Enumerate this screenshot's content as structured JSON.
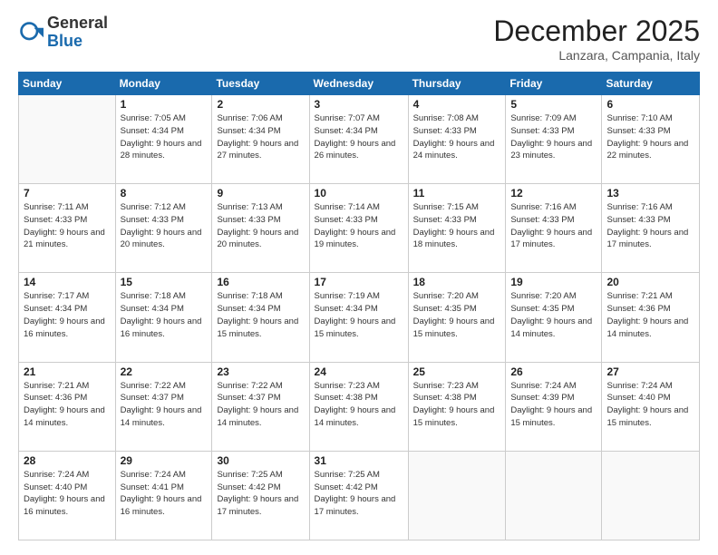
{
  "header": {
    "logo_general": "General",
    "logo_blue": "Blue",
    "month_title": "December 2025",
    "location": "Lanzara, Campania, Italy"
  },
  "weekdays": [
    "Sunday",
    "Monday",
    "Tuesday",
    "Wednesday",
    "Thursday",
    "Friday",
    "Saturday"
  ],
  "weeks": [
    [
      {
        "day": "",
        "sunrise": "",
        "sunset": "",
        "daylight": ""
      },
      {
        "day": "1",
        "sunrise": "Sunrise: 7:05 AM",
        "sunset": "Sunset: 4:34 PM",
        "daylight": "Daylight: 9 hours and 28 minutes."
      },
      {
        "day": "2",
        "sunrise": "Sunrise: 7:06 AM",
        "sunset": "Sunset: 4:34 PM",
        "daylight": "Daylight: 9 hours and 27 minutes."
      },
      {
        "day": "3",
        "sunrise": "Sunrise: 7:07 AM",
        "sunset": "Sunset: 4:34 PM",
        "daylight": "Daylight: 9 hours and 26 minutes."
      },
      {
        "day": "4",
        "sunrise": "Sunrise: 7:08 AM",
        "sunset": "Sunset: 4:33 PM",
        "daylight": "Daylight: 9 hours and 24 minutes."
      },
      {
        "day": "5",
        "sunrise": "Sunrise: 7:09 AM",
        "sunset": "Sunset: 4:33 PM",
        "daylight": "Daylight: 9 hours and 23 minutes."
      },
      {
        "day": "6",
        "sunrise": "Sunrise: 7:10 AM",
        "sunset": "Sunset: 4:33 PM",
        "daylight": "Daylight: 9 hours and 22 minutes."
      }
    ],
    [
      {
        "day": "7",
        "sunrise": "Sunrise: 7:11 AM",
        "sunset": "Sunset: 4:33 PM",
        "daylight": "Daylight: 9 hours and 21 minutes."
      },
      {
        "day": "8",
        "sunrise": "Sunrise: 7:12 AM",
        "sunset": "Sunset: 4:33 PM",
        "daylight": "Daylight: 9 hours and 20 minutes."
      },
      {
        "day": "9",
        "sunrise": "Sunrise: 7:13 AM",
        "sunset": "Sunset: 4:33 PM",
        "daylight": "Daylight: 9 hours and 20 minutes."
      },
      {
        "day": "10",
        "sunrise": "Sunrise: 7:14 AM",
        "sunset": "Sunset: 4:33 PM",
        "daylight": "Daylight: 9 hours and 19 minutes."
      },
      {
        "day": "11",
        "sunrise": "Sunrise: 7:15 AM",
        "sunset": "Sunset: 4:33 PM",
        "daylight": "Daylight: 9 hours and 18 minutes."
      },
      {
        "day": "12",
        "sunrise": "Sunrise: 7:16 AM",
        "sunset": "Sunset: 4:33 PM",
        "daylight": "Daylight: 9 hours and 17 minutes."
      },
      {
        "day": "13",
        "sunrise": "Sunrise: 7:16 AM",
        "sunset": "Sunset: 4:33 PM",
        "daylight": "Daylight: 9 hours and 17 minutes."
      }
    ],
    [
      {
        "day": "14",
        "sunrise": "Sunrise: 7:17 AM",
        "sunset": "Sunset: 4:34 PM",
        "daylight": "Daylight: 9 hours and 16 minutes."
      },
      {
        "day": "15",
        "sunrise": "Sunrise: 7:18 AM",
        "sunset": "Sunset: 4:34 PM",
        "daylight": "Daylight: 9 hours and 16 minutes."
      },
      {
        "day": "16",
        "sunrise": "Sunrise: 7:18 AM",
        "sunset": "Sunset: 4:34 PM",
        "daylight": "Daylight: 9 hours and 15 minutes."
      },
      {
        "day": "17",
        "sunrise": "Sunrise: 7:19 AM",
        "sunset": "Sunset: 4:34 PM",
        "daylight": "Daylight: 9 hours and 15 minutes."
      },
      {
        "day": "18",
        "sunrise": "Sunrise: 7:20 AM",
        "sunset": "Sunset: 4:35 PM",
        "daylight": "Daylight: 9 hours and 15 minutes."
      },
      {
        "day": "19",
        "sunrise": "Sunrise: 7:20 AM",
        "sunset": "Sunset: 4:35 PM",
        "daylight": "Daylight: 9 hours and 14 minutes."
      },
      {
        "day": "20",
        "sunrise": "Sunrise: 7:21 AM",
        "sunset": "Sunset: 4:36 PM",
        "daylight": "Daylight: 9 hours and 14 minutes."
      }
    ],
    [
      {
        "day": "21",
        "sunrise": "Sunrise: 7:21 AM",
        "sunset": "Sunset: 4:36 PM",
        "daylight": "Daylight: 9 hours and 14 minutes."
      },
      {
        "day": "22",
        "sunrise": "Sunrise: 7:22 AM",
        "sunset": "Sunset: 4:37 PM",
        "daylight": "Daylight: 9 hours and 14 minutes."
      },
      {
        "day": "23",
        "sunrise": "Sunrise: 7:22 AM",
        "sunset": "Sunset: 4:37 PM",
        "daylight": "Daylight: 9 hours and 14 minutes."
      },
      {
        "day": "24",
        "sunrise": "Sunrise: 7:23 AM",
        "sunset": "Sunset: 4:38 PM",
        "daylight": "Daylight: 9 hours and 14 minutes."
      },
      {
        "day": "25",
        "sunrise": "Sunrise: 7:23 AM",
        "sunset": "Sunset: 4:38 PM",
        "daylight": "Daylight: 9 hours and 15 minutes."
      },
      {
        "day": "26",
        "sunrise": "Sunrise: 7:24 AM",
        "sunset": "Sunset: 4:39 PM",
        "daylight": "Daylight: 9 hours and 15 minutes."
      },
      {
        "day": "27",
        "sunrise": "Sunrise: 7:24 AM",
        "sunset": "Sunset: 4:40 PM",
        "daylight": "Daylight: 9 hours and 15 minutes."
      }
    ],
    [
      {
        "day": "28",
        "sunrise": "Sunrise: 7:24 AM",
        "sunset": "Sunset: 4:40 PM",
        "daylight": "Daylight: 9 hours and 16 minutes."
      },
      {
        "day": "29",
        "sunrise": "Sunrise: 7:24 AM",
        "sunset": "Sunset: 4:41 PM",
        "daylight": "Daylight: 9 hours and 16 minutes."
      },
      {
        "day": "30",
        "sunrise": "Sunrise: 7:25 AM",
        "sunset": "Sunset: 4:42 PM",
        "daylight": "Daylight: 9 hours and 17 minutes."
      },
      {
        "day": "31",
        "sunrise": "Sunrise: 7:25 AM",
        "sunset": "Sunset: 4:42 PM",
        "daylight": "Daylight: 9 hours and 17 minutes."
      },
      {
        "day": "",
        "sunrise": "",
        "sunset": "",
        "daylight": ""
      },
      {
        "day": "",
        "sunrise": "",
        "sunset": "",
        "daylight": ""
      },
      {
        "day": "",
        "sunrise": "",
        "sunset": "",
        "daylight": ""
      }
    ]
  ]
}
